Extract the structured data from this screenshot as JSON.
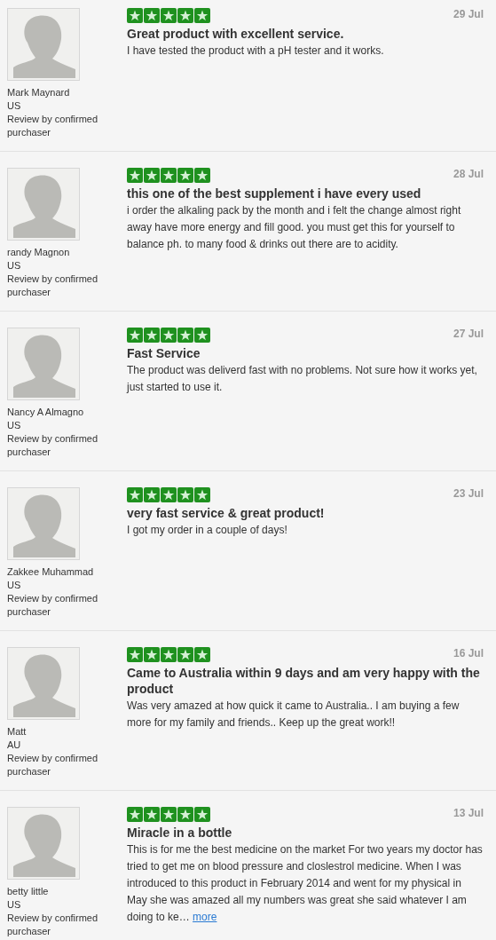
{
  "reviews": [
    {
      "author": "Mark Maynard",
      "country": "US",
      "badge": "Review by confirmed purchaser",
      "stars": 5,
      "date": "29 Jul",
      "title": "Great product with excellent service.",
      "body": "I have tested the product with a pH tester and it works."
    },
    {
      "author": "randy Magnon",
      "country": "US",
      "badge": "Review by confirmed purchaser",
      "stars": 5,
      "date": "28 Jul",
      "title": "this one of the best supplement i have every used",
      "body": "i order the alkaling pack by the month and i felt the change almost right away have more energy and fill good. you must get this for yourself to balance ph. to many food & drinks out there are to acidity."
    },
    {
      "author": "Nancy A Almagno",
      "country": "US",
      "badge": "Review by confirmed purchaser",
      "stars": 5,
      "date": "27 Jul",
      "title": "Fast Service",
      "body": "The product was deliverd fast with no problems. Not sure how it works yet, just started to use it."
    },
    {
      "author": "Zakkee Muhammad",
      "country": "US",
      "badge": "Review by confirmed purchaser",
      "stars": 5,
      "date": "23 Jul",
      "title": "very fast service & great product!",
      "body": "I got my order in a couple of days!"
    },
    {
      "author": "Matt",
      "country": "AU",
      "badge": "Review by confirmed purchaser",
      "stars": 5,
      "date": "16 Jul",
      "title": "Came to Australia within 9 days and am very happy with the product",
      "body": "Was very amazed at how quick it came to Australia.. I am buying a few more for my family and friends.. Keep up the great work!!"
    },
    {
      "author": "betty little",
      "country": "US",
      "badge": "Review by confirmed purchaser",
      "stars": 5,
      "date": "13 Jul",
      "title": "Miracle in a bottle",
      "body": "This is for me the best medicine on the market For two years my doctor has tried to get me on blood pressure and closlestrol medicine. When I was introduced to this product in February 2014 and went for my physical in May she was amazed all my numbers was great she said whatever I am doing to ke…",
      "more_link": "more"
    }
  ]
}
